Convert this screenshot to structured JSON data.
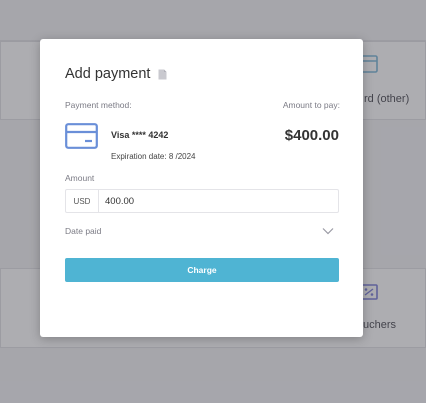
{
  "background": {
    "card_label_top": "rd (other)",
    "card_label_bottom": "uchers"
  },
  "modal": {
    "title": "Add payment",
    "payment_method_label": "Payment method:",
    "amount_to_pay_label": "Amount to pay:",
    "card_brand": "Visa **** 4242",
    "expiration": "Expiration date: 8 /2024",
    "amount_due": "$400.00",
    "amount_label": "Amount",
    "currency": "USD",
    "amount_value": "400.00",
    "date_paid_placeholder": "Date paid",
    "charge_label": "Charge"
  },
  "colors": {
    "accent": "#4fb4d3",
    "card_icon": "#6a8fd8",
    "bg_icon": "#7b7fd8"
  }
}
